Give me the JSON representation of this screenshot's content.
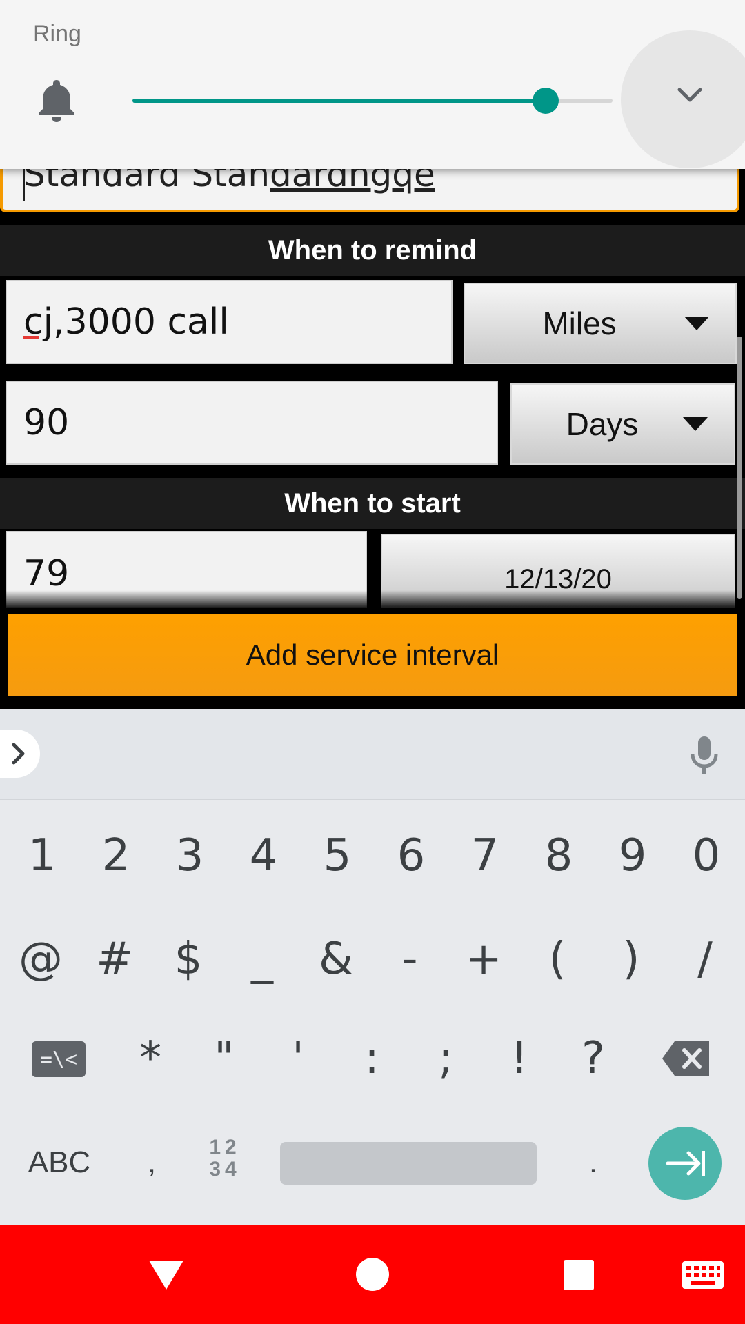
{
  "volume_panel": {
    "label": "Ring",
    "level": 0.86,
    "icon": "bell-icon",
    "collapse_icon": "chevron-down-icon",
    "accent_color": "#009688"
  },
  "form": {
    "name_value": "Standard Standardngqe",
    "name_plain": "Standard Stan",
    "name_underlined": "dardngqe",
    "remind_header": "When to remind",
    "distance_value_err": "cj",
    "distance_value_rest": ",3000 call",
    "distance_unit": "Miles",
    "time_value": "90",
    "time_unit": "Days",
    "start_header": "When to start",
    "start_value": "79",
    "start_date": "12/13/20",
    "add_button_label": "Add service interval",
    "accent_color": "#fea000"
  },
  "keyboard": {
    "row1": [
      "1",
      "2",
      "3",
      "4",
      "5",
      "6",
      "7",
      "8",
      "9",
      "0"
    ],
    "row2": [
      "@",
      "#",
      "$",
      "_",
      "&",
      "-",
      "+",
      "(",
      ")",
      "/"
    ],
    "row3": [
      "*",
      "\"",
      "'",
      ":",
      ";",
      "!",
      "?"
    ],
    "symbols_key": "=\\<",
    "abc_key": "ABC",
    "comma_key": ",",
    "numpad_key_top": "12",
    "numpad_key_bottom": "34",
    "period_key": ".",
    "icons": [
      "expand-icon",
      "mic-icon",
      "backspace-icon",
      "next-field-icon"
    ]
  },
  "navbar": {
    "background": "#ff0000",
    "icons": [
      "back-icon",
      "home-icon",
      "recents-icon",
      "keyboard-icon"
    ]
  }
}
